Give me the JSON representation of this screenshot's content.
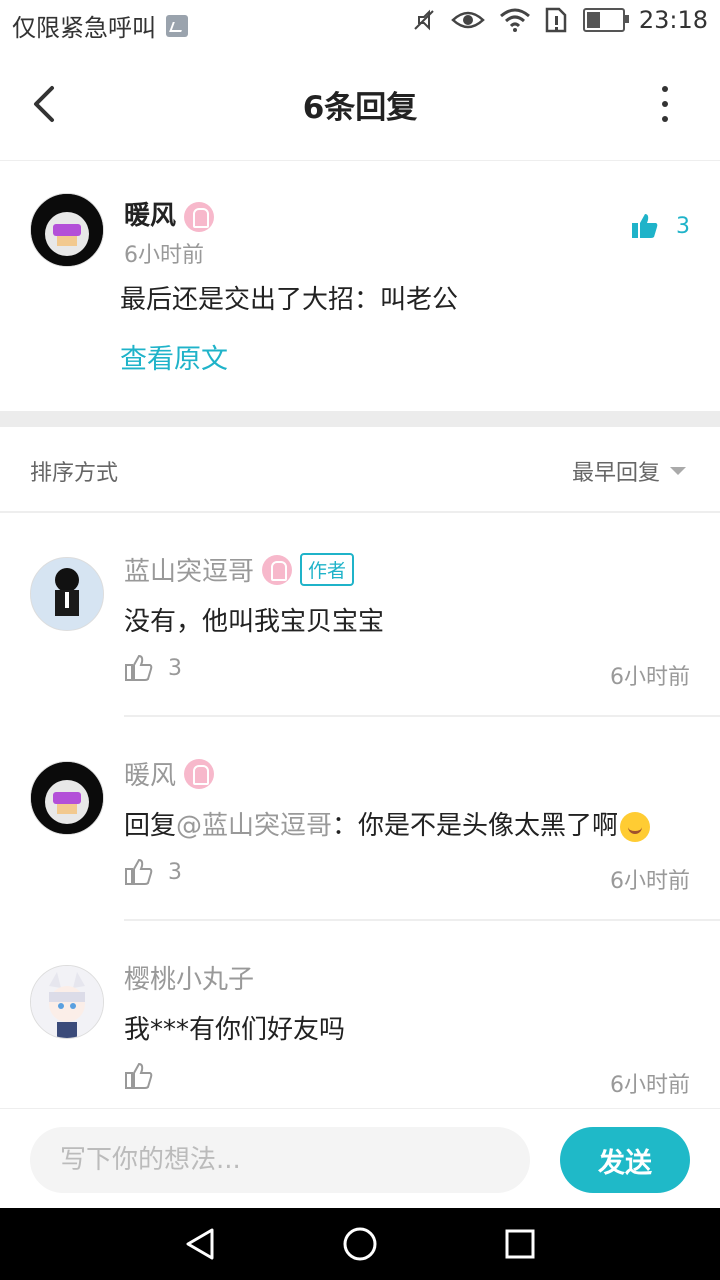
{
  "status": {
    "carrier": "仅限紧急呼叫",
    "time": "23:18",
    "battery_percent": 40
  },
  "header": {
    "title": "6条回复"
  },
  "main_comment": {
    "username": "暖风",
    "time": "6小时前",
    "text": "最后还是交出了大招：叫老公",
    "view_original": "查看原文",
    "likes": "3"
  },
  "sort": {
    "label": "排序方式",
    "value": "最早回复"
  },
  "replies": [
    {
      "username": "蓝山突逗哥",
      "author_tag": "作者",
      "content": "没有，他叫我宝贝宝宝",
      "likes": "3",
      "time": "6小时前"
    },
    {
      "username": "暖风",
      "prefix": "回复",
      "mention": "@蓝山突逗哥",
      "content": "：你是不是头像太黑了啊",
      "likes": "3",
      "time": "6小时前"
    },
    {
      "username": "樱桃小丸子",
      "content": "我***有你们好友吗",
      "likes": "",
      "time": "6小时前"
    }
  ],
  "input": {
    "placeholder": "写下你的想法..."
  },
  "send_label": "发送",
  "colors": {
    "accent": "#1fb9c8",
    "badge": "#f7b8cb"
  }
}
